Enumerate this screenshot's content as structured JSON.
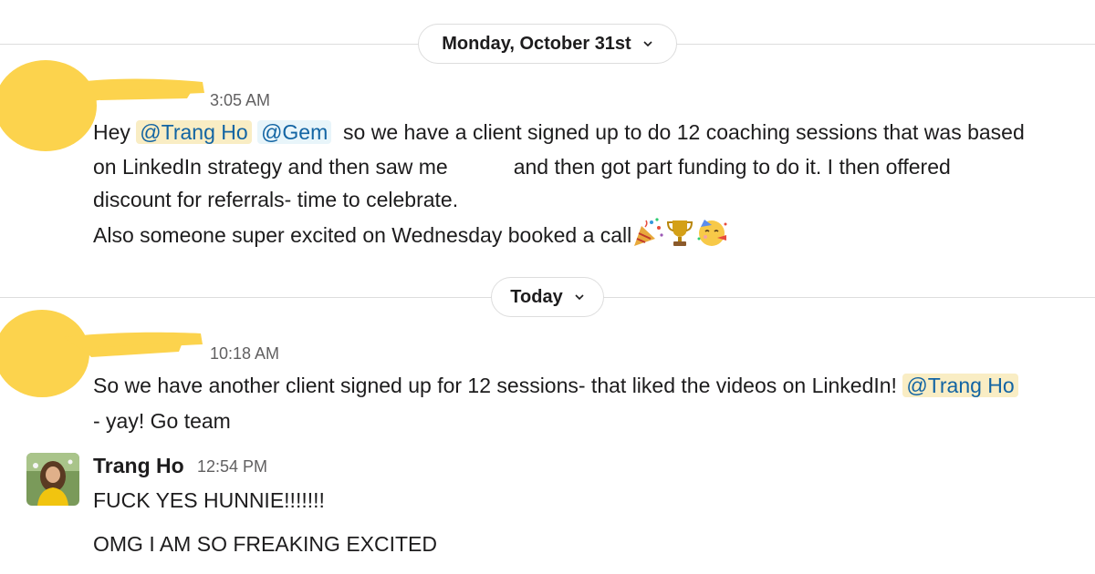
{
  "date_dividers": [
    {
      "label": "Monday, October 31st"
    },
    {
      "label": "Today"
    }
  ],
  "messages": [
    {
      "author": "",
      "time": "3:05 AM",
      "line1": {
        "prefix": "Hey ",
        "mention1": "@Trang Ho",
        "mention2": "@Gem",
        "suffix": " so we have a client signed up to do 12 coaching sessions that was based"
      },
      "line2": {
        "before": "on LinkedIn strategy and then saw me",
        "after": "and then got part funding to do it.  I then offered"
      },
      "line3": "discount for referrals- time to celebrate.",
      "line4": "Also someone super excited on Wednesday booked a call",
      "emojis": [
        "party-popper-icon",
        "trophy-icon",
        "partying-face-icon"
      ]
    },
    {
      "author": "",
      "time": "10:18 AM",
      "line1": {
        "text": "So we have another client signed up for 12 sessions- that liked the videos on LinkedIn!",
        "mention": "@Trang Ho"
      },
      "line2": "- yay! Go team"
    },
    {
      "author": "Trang Ho",
      "time": "12:54 PM",
      "line1": "FUCK YES HUNNIE!!!!!!!",
      "line2": "OMG I AM SO FREAKING EXCITED"
    }
  ],
  "colors": {
    "mention_text": "#1264a3",
    "mention_bg": "#f9edc4",
    "redaction": "#fcd34d",
    "timestamp": "#616061"
  }
}
